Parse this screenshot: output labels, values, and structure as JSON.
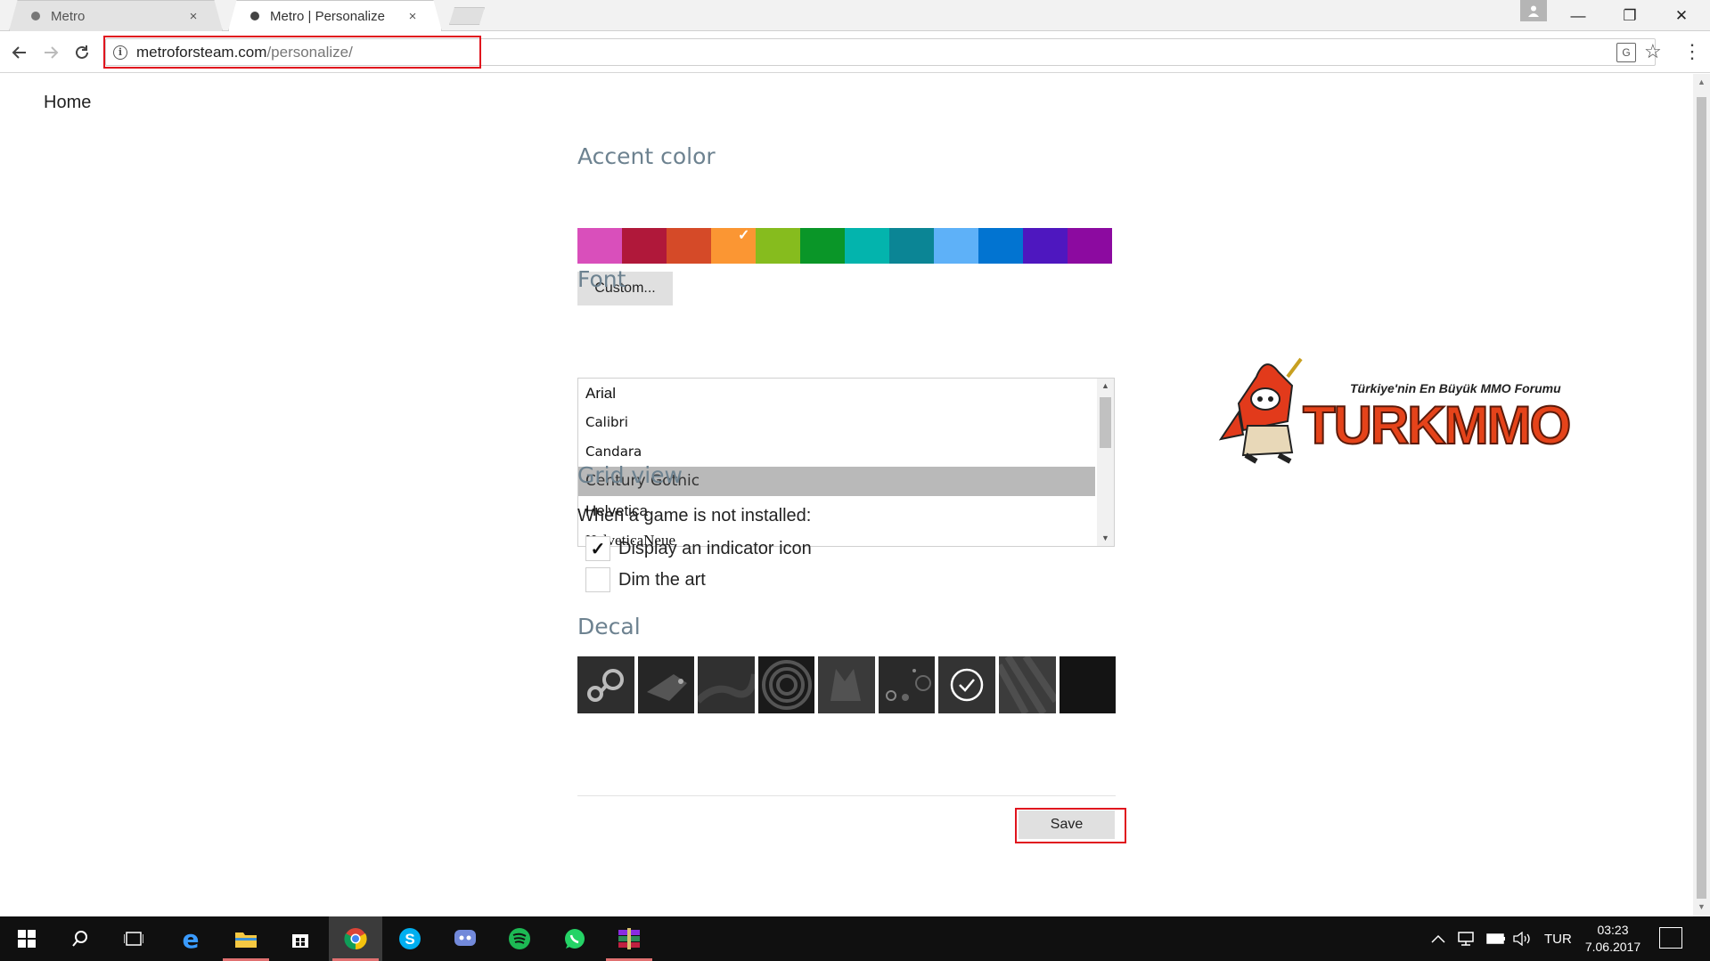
{
  "browser": {
    "tabs": [
      {
        "label": "Metro",
        "close": "×"
      },
      {
        "label": "Metro | Personalize",
        "close": "×"
      }
    ],
    "url_domain": "metroforsteam.com",
    "url_path": "/personalize/",
    "window_controls": {
      "minimize": "—",
      "restore": "❐",
      "close": "✕"
    }
  },
  "page": {
    "home_label": "Home",
    "accent": {
      "title": "Accent color",
      "swatches": [
        "#d94fbb",
        "#b0183a",
        "#d54a28",
        "#fb9633",
        "#86bc1e",
        "#0a9628",
        "#03b4ad",
        "#0b8595",
        "#5eb1f8",
        "#0274d1",
        "#4e17bf",
        "#8c0aa0"
      ],
      "selected_index": 3,
      "custom_label": "Custom..."
    },
    "font": {
      "title": "Font",
      "options": [
        "Arial",
        "Calibri",
        "Candara",
        "Century Gothic",
        "Helvetica",
        "HelveticaNeue"
      ],
      "selected_index": 3
    },
    "grid": {
      "title": "Grid view",
      "prompt": "When a game is not installed:",
      "options": [
        {
          "label": "Display an indicator icon",
          "checked": true
        },
        {
          "label": "Dim the art",
          "checked": false
        }
      ]
    },
    "decal": {
      "title": "Decal",
      "selected_index": 6
    },
    "save_label": "Save"
  },
  "logo": {
    "tagline": "Türkiye'nin En Büyük MMO Forumu",
    "wordmark": "TURKMMO"
  },
  "taskbar": {
    "language": "TUR",
    "time": "03:23",
    "date": "7.06.2017"
  }
}
